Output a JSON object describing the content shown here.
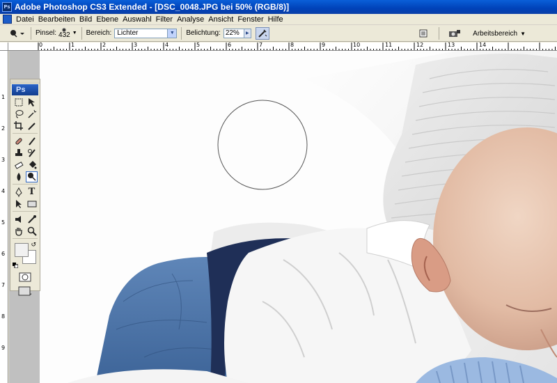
{
  "window": {
    "title": "Adobe Photoshop CS3 Extended - [DSC_0048.JPG bei 50% (RGB/8)]",
    "logo_text": "Ps"
  },
  "menu": [
    "Datei",
    "Bearbeiten",
    "Bild",
    "Ebene",
    "Auswahl",
    "Filter",
    "Analyse",
    "Ansicht",
    "Fenster",
    "Hilfe"
  ],
  "options": {
    "brush_label": "Pinsel:",
    "brush_size": "432",
    "range_label": "Bereich:",
    "range_value": "Lichter",
    "exposure_label": "Belichtung:",
    "exposure_value": "22%",
    "workspace_label": "Arbeitsbereich"
  },
  "rulers": {
    "top": [
      "0",
      "1",
      "2",
      "3",
      "4",
      "5",
      "6",
      "7",
      "8",
      "9",
      "10",
      "11",
      "12",
      "13",
      "14"
    ],
    "left": [
      "1",
      "2",
      "3",
      "4",
      "5",
      "6",
      "7",
      "8",
      "9"
    ]
  },
  "toolbox": {
    "badge": "Ps",
    "active_tool": "dodge",
    "foreground_color": "#f1f1f1",
    "background_color": "#ffffff"
  },
  "icons": {
    "tool_preset": "dodge-icon",
    "airbrush": "airbrush-icon",
    "palette_well": "palette-well-icon",
    "bridge": "bridge-icon"
  }
}
